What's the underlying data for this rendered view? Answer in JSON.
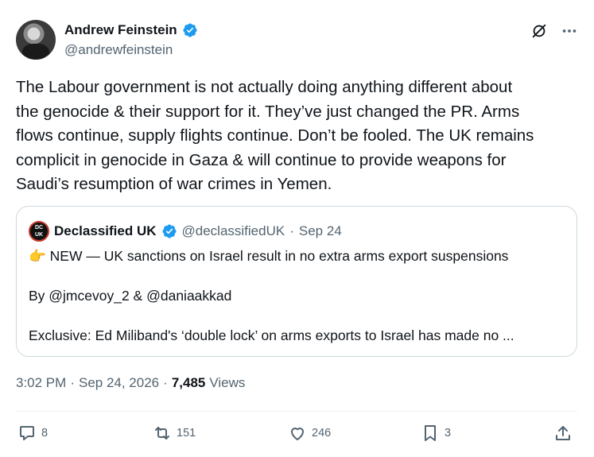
{
  "author": {
    "name": "Andrew Feinstein",
    "handle": "@andrewfeinstein"
  },
  "tweet": {
    "text": "The Labour government is not actually doing anything different about\nthe genocide & their support for it. They’ve just changed the PR. Arms\nflows continue, supply flights continue. Don’t be fooled. The UK remains\ncomplicit in genocide in Gaza & will continue to provide weapons for\nSaudi’s resumption of war crimes in Yemen."
  },
  "quote": {
    "logo_line1": "DC",
    "logo_line2": "UK",
    "name": "Declassified UK",
    "handle": "@declassifiedUK",
    "separator": "·",
    "date": "Sep 24",
    "emoji": "👉",
    "line1": "NEW — UK sanctions on Israel result in no extra arms export suspensions",
    "line2": "By @jmcevoy_2 & @daniaakkad",
    "line3": "Exclusive: Ed Miliband's ‘double lock’ on arms exports to Israel has made no ..."
  },
  "meta": {
    "time": "3:02 PM",
    "dot1": "·",
    "date": "Sep 24, 2026",
    "dot2": "·",
    "views": "7,485",
    "views_label": "Views"
  },
  "actions": {
    "replies": "8",
    "reposts": "151",
    "likes": "246",
    "bookmarks": "3"
  },
  "icons": [
    "verified-badge-icon",
    "grok-icon",
    "more-icon",
    "reply-icon",
    "repost-icon",
    "like-icon",
    "bookmark-icon",
    "share-icon"
  ],
  "colors": {
    "verified": "#1d9bf0",
    "secondary_text": "#536471",
    "border": "#cfd9de"
  }
}
